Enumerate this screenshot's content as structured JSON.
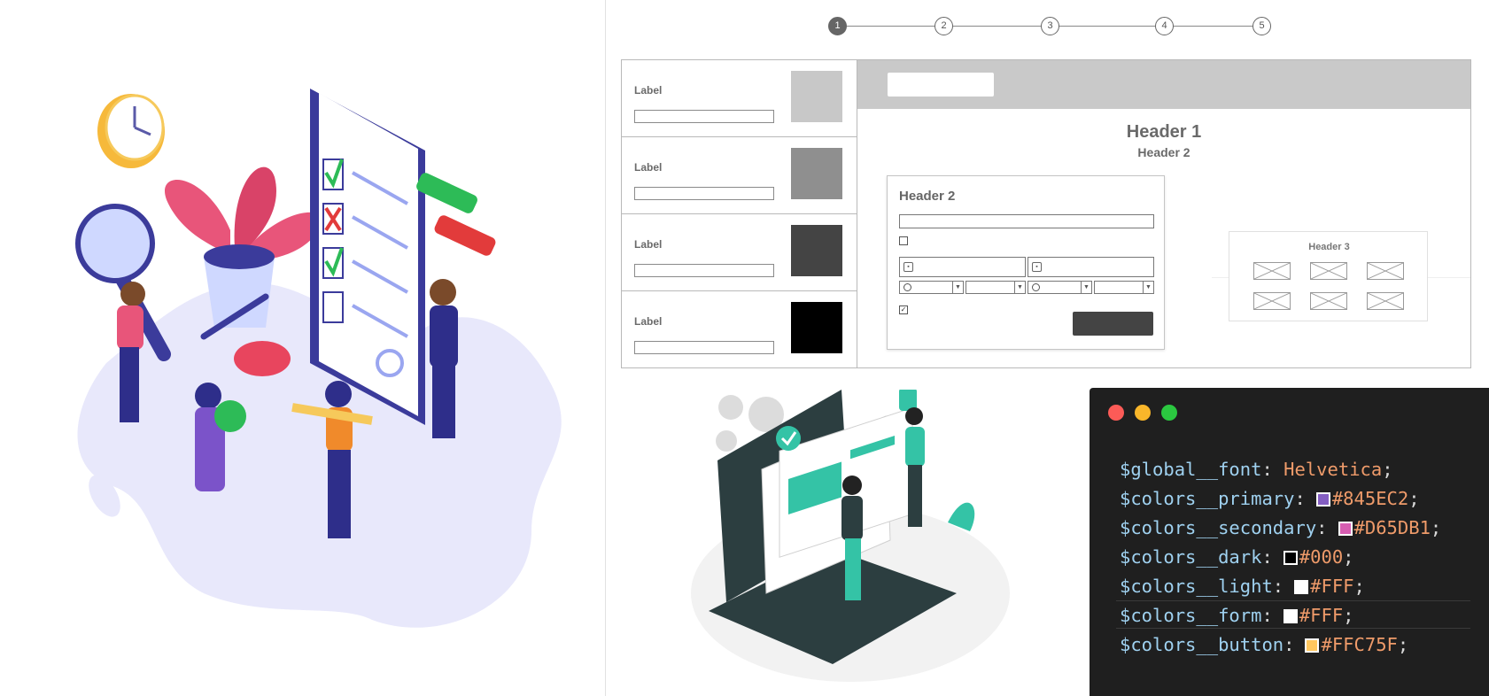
{
  "stepper": {
    "steps": [
      "1",
      "2",
      "3",
      "4",
      "5"
    ],
    "active_step": 1
  },
  "wireframe": {
    "list": [
      {
        "label": "Label",
        "swatch": "#c8c8c8"
      },
      {
        "label": "Label",
        "swatch": "#8f8f8f"
      },
      {
        "label": "Label",
        "swatch": "#444444"
      },
      {
        "label": "Label",
        "swatch": "#000000"
      }
    ],
    "header1": "Header 1",
    "header2": "Header 2",
    "form_title": "Header 2",
    "header3": "Header 3"
  },
  "editor": {
    "window_dots": [
      "#fc5b57",
      "#f9b62a",
      "#2bc840"
    ],
    "lines": [
      {
        "var": "$global__font",
        "value": "Helvetica",
        "swatch": null
      },
      {
        "var": "$colors__primary",
        "value": "#845EC2",
        "swatch": "#845EC2"
      },
      {
        "var": "$colors__secondary",
        "value": "#D65DB1",
        "swatch": "#D65DB1"
      },
      {
        "var": "$colors__dark",
        "value": "#000",
        "swatch": "#000000"
      },
      {
        "var": "$colors__light",
        "value": "#FFF",
        "swatch": "#FFFFFF"
      },
      {
        "var": "$colors__form",
        "value": "#FFF",
        "swatch": "#FFFFFF"
      },
      {
        "var": "$colors__button",
        "value": "#FFC75F",
        "swatch": "#FFC75F"
      }
    ]
  },
  "illustrations": {
    "left": "checklist-team-illustration",
    "middle": "website-builder-illustration"
  }
}
